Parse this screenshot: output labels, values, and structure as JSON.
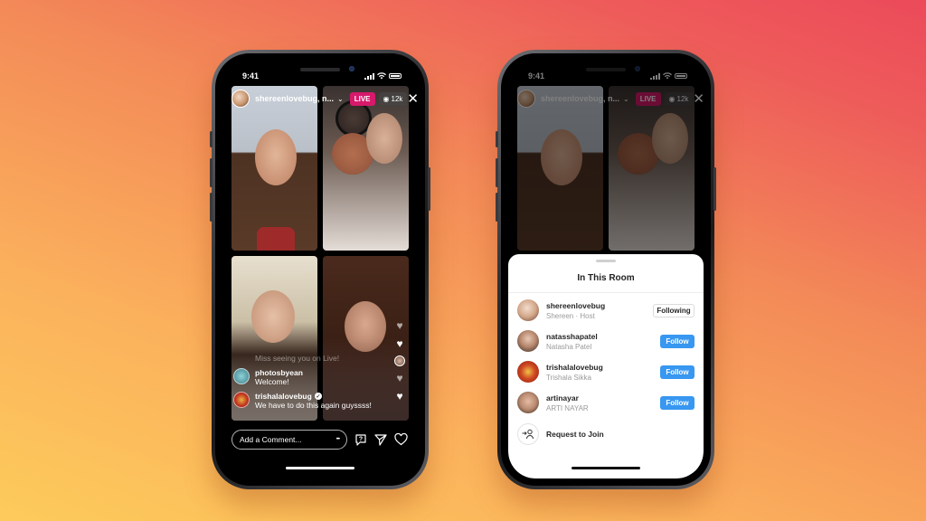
{
  "status_bar": {
    "time": "9:41"
  },
  "live": {
    "host_title": "shereenlovebug, n...",
    "live_label": "LIVE",
    "viewer_count": "12k",
    "comments": [
      {
        "user": "",
        "text": "Miss seeing you on Live!",
        "faded": true
      },
      {
        "user": "photosbyean",
        "text": "Welcome!",
        "verified": false
      },
      {
        "user": "trishalalovebug",
        "text": "We have to do this again guyssss!",
        "verified": true
      }
    ],
    "comment_placeholder": "Add a Comment...",
    "more_label": "•••"
  },
  "room": {
    "title": "In This Room",
    "members": [
      {
        "username": "shereenlovebug",
        "subtitle": "Shereen · Host",
        "action": "Following"
      },
      {
        "username": "natasshapatel",
        "subtitle": "Natasha Patel",
        "action": "Follow"
      },
      {
        "username": "trishalalovebug",
        "subtitle": "Trishala Sikka",
        "action": "Follow"
      },
      {
        "username": "artinayar",
        "subtitle": "ARTI NAYAR",
        "action": "Follow"
      }
    ],
    "request_label": "Request to Join"
  },
  "colors": {
    "live_badge": "#d6196b",
    "follow_button": "#3897f0"
  }
}
